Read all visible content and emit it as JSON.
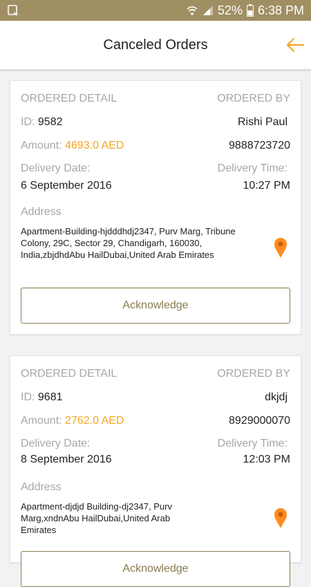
{
  "status_bar": {
    "battery": "52%",
    "time": "6:38 PM",
    "icons": [
      "phone-icon",
      "wifi-icon",
      "signal-icon",
      "battery-icon"
    ]
  },
  "header": {
    "title": "Canceled Orders",
    "back_icon": "arrow-left-icon"
  },
  "colors": {
    "accent": "#f5a623",
    "gold": "#8a7a4f",
    "status_bar": "#a08f63"
  },
  "orders": [
    {
      "detail_label": "ORDERED DETAIL",
      "by_label": "ORDERED BY",
      "id_label": "ID:",
      "id": "9582",
      "name": "Rishi Paul",
      "amount_label": "Amount:",
      "amount": "4693.0 AED",
      "phone": "9888723720",
      "delivery_date_label": "Delivery Date:",
      "delivery_date": "6 September 2016",
      "delivery_time_label": "Delivery Time:",
      "delivery_time": "10:27 PM",
      "address_label": "Address",
      "address": "Apartment-Building-hjdddhdj2347, Purv Marg, Tribune Colony, 29C, Sector 29, Chandigarh, 160030, India,zbjdhdAbu HailDubai,United Arab Emirates",
      "button": "Acknowledge"
    },
    {
      "detail_label": "ORDERED DETAIL",
      "by_label": "ORDERED BY",
      "id_label": "ID:",
      "id": "9681",
      "name": "dkjdj",
      "amount_label": "Amount:",
      "amount": "2762.0 AED",
      "phone": "8929000070",
      "delivery_date_label": "Delivery Date:",
      "delivery_date": "8 September 2016",
      "delivery_time_label": "Delivery Time:",
      "delivery_time": "12:03 PM",
      "address_label": "Address",
      "address": "Apartment-djdjd Building-dj2347, Purv Marg,xndnAbu HailDubai,United Arab Emirates",
      "button": "Acknowledge"
    }
  ]
}
